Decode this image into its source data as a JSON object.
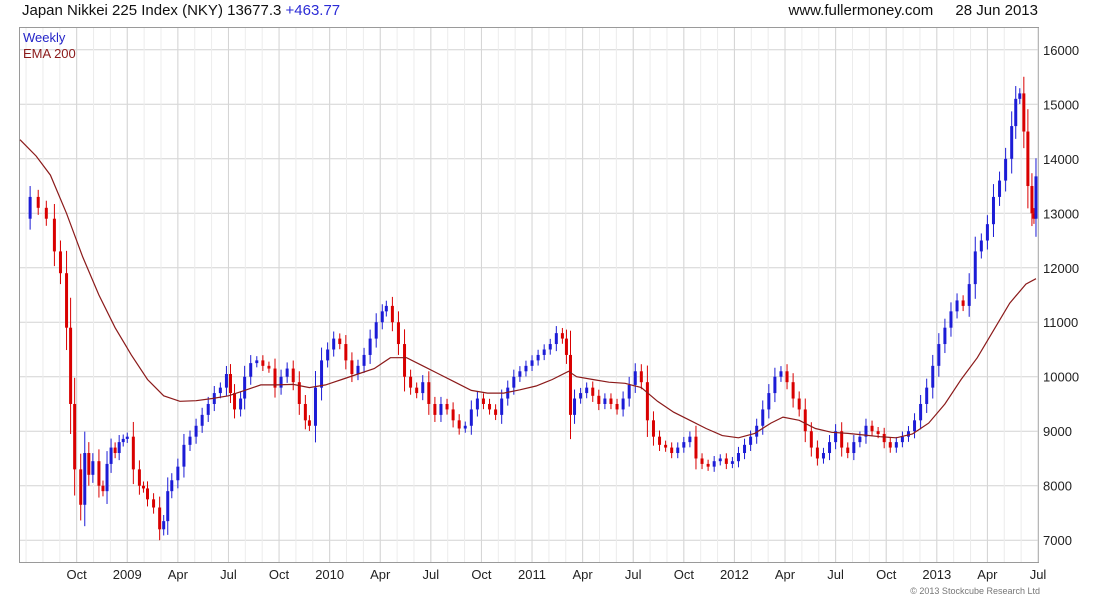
{
  "header": {
    "title": "Japan Nikkei 225 Index (NKY)",
    "last": "13677.3",
    "change": "+463.77",
    "site": "www.fullermoney.com",
    "date": "28 Jun 2013"
  },
  "legend": {
    "frequency": "Weekly",
    "overlay": "EMA 200"
  },
  "copyright": "© 2013 Stockcube Research Ltd",
  "colors": {
    "up": "#1c1cd6",
    "down": "#d90000",
    "ema": "#8b1a1a",
    "grid": "#d4d4d4",
    "frame": "#9a9a9a"
  },
  "chart_data": {
    "type": "candlestick",
    "y_axis_side": "right",
    "ylim": [
      6600,
      16400
    ],
    "y_ticks": [
      7000,
      8000,
      9000,
      10000,
      11000,
      12000,
      13000,
      14000,
      15000,
      16000
    ],
    "x_ticks": [
      {
        "t": 2008.75,
        "label": "Oct"
      },
      {
        "t": 2009.0,
        "label": "2009"
      },
      {
        "t": 2009.25,
        "label": "Apr"
      },
      {
        "t": 2009.5,
        "label": "Jul"
      },
      {
        "t": 2009.75,
        "label": "Oct"
      },
      {
        "t": 2010.0,
        "label": "2010"
      },
      {
        "t": 2010.25,
        "label": "Apr"
      },
      {
        "t": 2010.5,
        "label": "Jul"
      },
      {
        "t": 2010.75,
        "label": "Oct"
      },
      {
        "t": 2011.0,
        "label": "2011"
      },
      {
        "t": 2011.25,
        "label": "Apr"
      },
      {
        "t": 2011.5,
        "label": "Jul"
      },
      {
        "t": 2011.75,
        "label": "Oct"
      },
      {
        "t": 2012.0,
        "label": "2012"
      },
      {
        "t": 2012.25,
        "label": "Apr"
      },
      {
        "t": 2012.5,
        "label": "Jul"
      },
      {
        "t": 2012.75,
        "label": "Oct"
      },
      {
        "t": 2013.0,
        "label": "2013"
      },
      {
        "t": 2013.25,
        "label": "Apr"
      },
      {
        "t": 2013.5,
        "label": "Jul"
      }
    ],
    "x_range": [
      2008.47,
      2013.5
    ],
    "grid": true,
    "series": [
      {
        "name": "Weekly",
        "kind": "close",
        "points": [
          [
            2008.48,
            12900
          ],
          [
            2008.52,
            13300
          ],
          [
            2008.56,
            13100
          ],
          [
            2008.6,
            12900
          ],
          [
            2008.64,
            12300
          ],
          [
            2008.67,
            11900
          ],
          [
            2008.7,
            10900
          ],
          [
            2008.72,
            9500
          ],
          [
            2008.74,
            8300
          ],
          [
            2008.77,
            7650
          ],
          [
            2008.79,
            8600
          ],
          [
            2008.81,
            8200
          ],
          [
            2008.83,
            8450
          ],
          [
            2008.86,
            8000
          ],
          [
            2008.88,
            7900
          ],
          [
            2008.9,
            8400
          ],
          [
            2008.92,
            8700
          ],
          [
            2008.94,
            8600
          ],
          [
            2008.96,
            8800
          ],
          [
            2008.98,
            8859
          ],
          [
            2009.0,
            8900
          ],
          [
            2009.03,
            8300
          ],
          [
            2009.06,
            8000
          ],
          [
            2009.08,
            7950
          ],
          [
            2009.1,
            7750
          ],
          [
            2009.13,
            7600
          ],
          [
            2009.16,
            7200
          ],
          [
            2009.18,
            7350
          ],
          [
            2009.2,
            7900
          ],
          [
            2009.22,
            8100
          ],
          [
            2009.25,
            8350
          ],
          [
            2009.28,
            8750
          ],
          [
            2009.31,
            8900
          ],
          [
            2009.34,
            9100
          ],
          [
            2009.37,
            9300
          ],
          [
            2009.4,
            9500
          ],
          [
            2009.43,
            9700
          ],
          [
            2009.46,
            9800
          ],
          [
            2009.49,
            10050
          ],
          [
            2009.51,
            9700
          ],
          [
            2009.53,
            9400
          ],
          [
            2009.56,
            9600
          ],
          [
            2009.58,
            10000
          ],
          [
            2009.61,
            10250
          ],
          [
            2009.64,
            10300
          ],
          [
            2009.67,
            10200
          ],
          [
            2009.7,
            10150
          ],
          [
            2009.73,
            9800
          ],
          [
            2009.76,
            10000
          ],
          [
            2009.79,
            10150
          ],
          [
            2009.82,
            9900
          ],
          [
            2009.85,
            9500
          ],
          [
            2009.88,
            9200
          ],
          [
            2009.9,
            9100
          ],
          [
            2009.93,
            9800
          ],
          [
            2009.96,
            10300
          ],
          [
            2009.99,
            10500
          ],
          [
            2010.02,
            10700
          ],
          [
            2010.05,
            10600
          ],
          [
            2010.08,
            10300
          ],
          [
            2010.11,
            10050
          ],
          [
            2010.14,
            10200
          ],
          [
            2010.17,
            10400
          ],
          [
            2010.2,
            10700
          ],
          [
            2010.23,
            11000
          ],
          [
            2010.26,
            11200
          ],
          [
            2010.28,
            11300
          ],
          [
            2010.31,
            11000
          ],
          [
            2010.34,
            10600
          ],
          [
            2010.37,
            10000
          ],
          [
            2010.4,
            9800
          ],
          [
            2010.43,
            9700
          ],
          [
            2010.46,
            9900
          ],
          [
            2010.49,
            9500
          ],
          [
            2010.52,
            9300
          ],
          [
            2010.55,
            9500
          ],
          [
            2010.58,
            9400
          ],
          [
            2010.61,
            9200
          ],
          [
            2010.64,
            9050
          ],
          [
            2010.67,
            9100
          ],
          [
            2010.7,
            9400
          ],
          [
            2010.73,
            9600
          ],
          [
            2010.76,
            9500
          ],
          [
            2010.79,
            9400
          ],
          [
            2010.82,
            9300
          ],
          [
            2010.85,
            9600
          ],
          [
            2010.88,
            9800
          ],
          [
            2010.91,
            10000
          ],
          [
            2010.94,
            10100
          ],
          [
            2010.97,
            10200
          ],
          [
            2011.0,
            10300
          ],
          [
            2011.03,
            10400
          ],
          [
            2011.06,
            10500
          ],
          [
            2011.09,
            10600
          ],
          [
            2011.12,
            10800
          ],
          [
            2011.15,
            10700
          ],
          [
            2011.17,
            10400
          ],
          [
            2011.19,
            9300
          ],
          [
            2011.21,
            9600
          ],
          [
            2011.24,
            9700
          ],
          [
            2011.27,
            9800
          ],
          [
            2011.3,
            9650
          ],
          [
            2011.33,
            9500
          ],
          [
            2011.36,
            9600
          ],
          [
            2011.39,
            9500
          ],
          [
            2011.42,
            9400
          ],
          [
            2011.45,
            9600
          ],
          [
            2011.48,
            9850
          ],
          [
            2011.51,
            10100
          ],
          [
            2011.54,
            9900
          ],
          [
            2011.57,
            9200
          ],
          [
            2011.6,
            8900
          ],
          [
            2011.63,
            8750
          ],
          [
            2011.66,
            8700
          ],
          [
            2011.69,
            8600
          ],
          [
            2011.72,
            8700
          ],
          [
            2011.75,
            8800
          ],
          [
            2011.78,
            8900
          ],
          [
            2011.81,
            8500
          ],
          [
            2011.84,
            8400
          ],
          [
            2011.87,
            8350
          ],
          [
            2011.9,
            8450
          ],
          [
            2011.93,
            8500
          ],
          [
            2011.96,
            8400
          ],
          [
            2011.99,
            8450
          ],
          [
            2012.02,
            8600
          ],
          [
            2012.05,
            8750
          ],
          [
            2012.08,
            8900
          ],
          [
            2012.11,
            9100
          ],
          [
            2012.14,
            9400
          ],
          [
            2012.17,
            9700
          ],
          [
            2012.2,
            10000
          ],
          [
            2012.23,
            10100
          ],
          [
            2012.26,
            9900
          ],
          [
            2012.29,
            9600
          ],
          [
            2012.32,
            9400
          ],
          [
            2012.35,
            9000
          ],
          [
            2012.38,
            8700
          ],
          [
            2012.41,
            8500
          ],
          [
            2012.44,
            8600
          ],
          [
            2012.47,
            8800
          ],
          [
            2012.5,
            9000
          ],
          [
            2012.53,
            8700
          ],
          [
            2012.56,
            8600
          ],
          [
            2012.59,
            8800
          ],
          [
            2012.62,
            8900
          ],
          [
            2012.65,
            9100
          ],
          [
            2012.68,
            9000
          ],
          [
            2012.71,
            8950
          ],
          [
            2012.74,
            8800
          ],
          [
            2012.77,
            8700
          ],
          [
            2012.8,
            8800
          ],
          [
            2012.83,
            8900
          ],
          [
            2012.86,
            9000
          ],
          [
            2012.89,
            9200
          ],
          [
            2012.92,
            9500
          ],
          [
            2012.95,
            9800
          ],
          [
            2012.98,
            10200
          ],
          [
            2013.01,
            10600
          ],
          [
            2013.04,
            10900
          ],
          [
            2013.07,
            11200
          ],
          [
            2013.1,
            11400
          ],
          [
            2013.13,
            11300
          ],
          [
            2013.16,
            11700
          ],
          [
            2013.19,
            12300
          ],
          [
            2013.22,
            12500
          ],
          [
            2013.25,
            12800
          ],
          [
            2013.28,
            13300
          ],
          [
            2013.31,
            13600
          ],
          [
            2013.34,
            14000
          ],
          [
            2013.37,
            14600
          ],
          [
            2013.39,
            15100
          ],
          [
            2013.41,
            15200
          ],
          [
            2013.43,
            14500
          ],
          [
            2013.45,
            13500
          ],
          [
            2013.47,
            13000
          ],
          [
            2013.48,
            12900
          ],
          [
            2013.49,
            13677
          ]
        ]
      },
      {
        "name": "EMA 200",
        "kind": "line",
        "points": [
          [
            2008.47,
            14350
          ],
          [
            2008.55,
            14050
          ],
          [
            2008.62,
            13700
          ],
          [
            2008.7,
            13000
          ],
          [
            2008.78,
            12200
          ],
          [
            2008.86,
            11500
          ],
          [
            2008.94,
            10900
          ],
          [
            2009.02,
            10400
          ],
          [
            2009.1,
            9950
          ],
          [
            2009.18,
            9650
          ],
          [
            2009.26,
            9550
          ],
          [
            2009.34,
            9560
          ],
          [
            2009.42,
            9600
          ],
          [
            2009.5,
            9650
          ],
          [
            2009.58,
            9750
          ],
          [
            2009.66,
            9850
          ],
          [
            2009.74,
            9850
          ],
          [
            2009.82,
            9860
          ],
          [
            2009.9,
            9800
          ],
          [
            2009.98,
            9850
          ],
          [
            2010.06,
            9950
          ],
          [
            2010.14,
            10050
          ],
          [
            2010.22,
            10150
          ],
          [
            2010.3,
            10350
          ],
          [
            2010.38,
            10350
          ],
          [
            2010.46,
            10200
          ],
          [
            2010.54,
            10050
          ],
          [
            2010.62,
            9900
          ],
          [
            2010.7,
            9750
          ],
          [
            2010.78,
            9700
          ],
          [
            2010.86,
            9700
          ],
          [
            2010.94,
            9760
          ],
          [
            2011.02,
            9830
          ],
          [
            2011.1,
            9950
          ],
          [
            2011.18,
            10100
          ],
          [
            2011.22,
            10000
          ],
          [
            2011.3,
            9950
          ],
          [
            2011.38,
            9900
          ],
          [
            2011.46,
            9880
          ],
          [
            2011.54,
            9800
          ],
          [
            2011.62,
            9550
          ],
          [
            2011.7,
            9350
          ],
          [
            2011.78,
            9200
          ],
          [
            2011.86,
            9050
          ],
          [
            2011.94,
            8920
          ],
          [
            2012.02,
            8880
          ],
          [
            2012.1,
            8960
          ],
          [
            2012.18,
            9150
          ],
          [
            2012.24,
            9260
          ],
          [
            2012.32,
            9200
          ],
          [
            2012.4,
            9050
          ],
          [
            2012.48,
            8980
          ],
          [
            2012.56,
            8960
          ],
          [
            2012.64,
            8930
          ],
          [
            2012.72,
            8900
          ],
          [
            2012.8,
            8880
          ],
          [
            2012.88,
            8950
          ],
          [
            2012.96,
            9150
          ],
          [
            2013.04,
            9500
          ],
          [
            2013.12,
            9950
          ],
          [
            2013.2,
            10350
          ],
          [
            2013.28,
            10850
          ],
          [
            2013.36,
            11350
          ],
          [
            2013.44,
            11700
          ],
          [
            2013.49,
            11800
          ]
        ]
      }
    ]
  }
}
